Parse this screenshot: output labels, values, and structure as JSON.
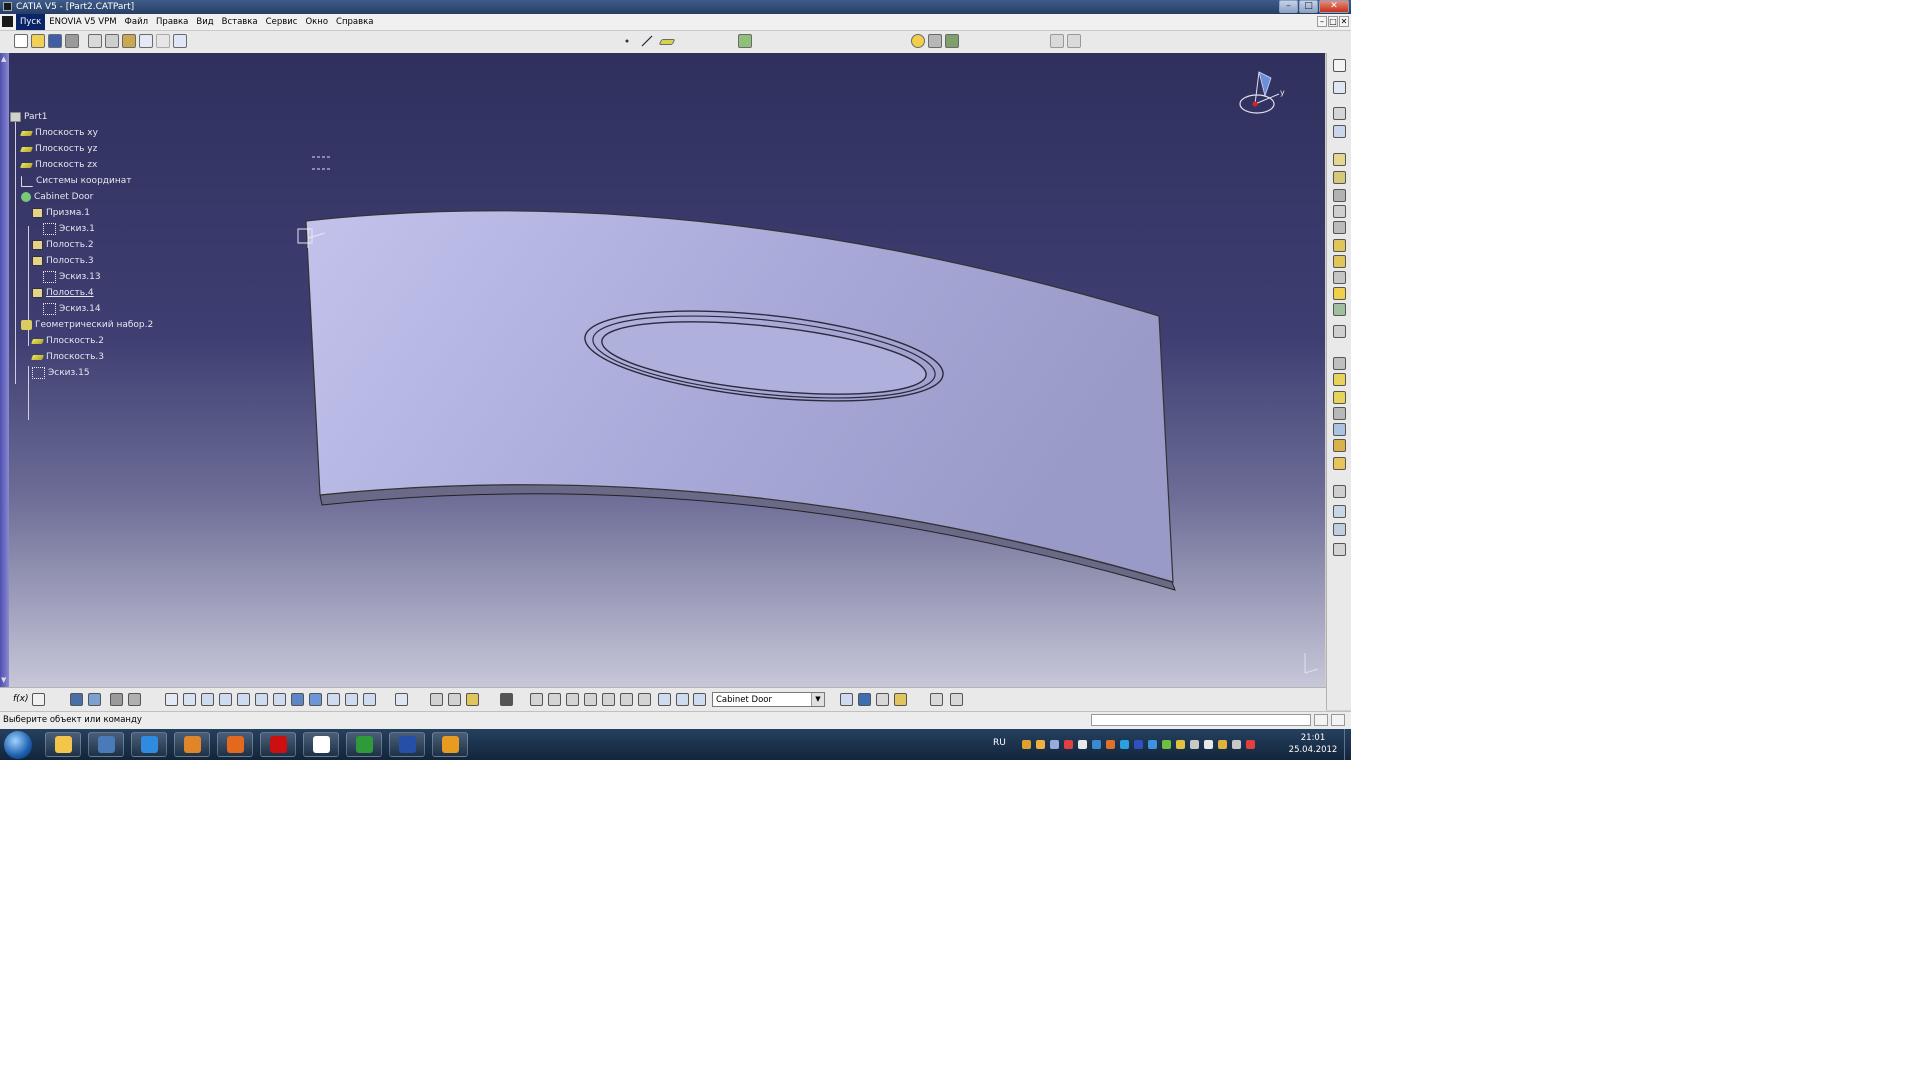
{
  "window": {
    "title": "CATIA V5 - [Part2.CATPart]",
    "controls": [
      "–",
      "□",
      "✕"
    ]
  },
  "menu": {
    "items": [
      "Пуск",
      "ENOVIA V5 VPM",
      "Файл",
      "Правка",
      "Вид",
      "Вставка",
      "Сервис",
      "Окно",
      "Справка"
    ],
    "active_index": 0,
    "doc_controls": [
      "–",
      "□",
      "✕"
    ]
  },
  "tree": {
    "nodes": [
      {
        "label": "Part1",
        "icon": "part-icon",
        "level": 0
      },
      {
        "label": "Плоскость xy",
        "icon": "plane-icon",
        "level": 1
      },
      {
        "label": "Плоскость yz",
        "icon": "plane-icon",
        "level": 1
      },
      {
        "label": "Плоскость zx",
        "icon": "plane-icon",
        "level": 1
      },
      {
        "label": "Системы координат",
        "icon": "axis-system-icon",
        "level": 1
      },
      {
        "label": "Cabinet Door",
        "icon": "part-body-icon",
        "level": 1
      },
      {
        "label": "Призма.1",
        "icon": "pad-icon",
        "level": 2
      },
      {
        "label": "Эскиз.1",
        "icon": "sketch-icon",
        "level": 3
      },
      {
        "label": "Полость.2",
        "icon": "pocket-icon",
        "level": 2
      },
      {
        "label": "Полость.3",
        "icon": "pocket-icon",
        "level": 2
      },
      {
        "label": "Эскиз.13",
        "icon": "sketch-icon",
        "level": 3
      },
      {
        "label": "Полость.4",
        "icon": "pocket-icon",
        "level": 2
      },
      {
        "label": "Эскиз.14",
        "icon": "sketch-icon",
        "level": 3
      },
      {
        "label": "Геометрический набор.2",
        "icon": "geometrical-set-icon",
        "level": 1
      },
      {
        "label": "Плоскость.2",
        "icon": "plane-icon",
        "level": 2
      },
      {
        "label": "Плоскость.3",
        "icon": "plane-icon",
        "level": 2
      },
      {
        "label": "Эскиз.15",
        "icon": "sketch-icon",
        "level": 2
      }
    ],
    "current_index": 11
  },
  "compass": {
    "axis_label": "y"
  },
  "bottom_toolbar": {
    "fx_label": "f(x)",
    "body_combo_value": "Cabinet Door"
  },
  "status": {
    "message": "Выберите объект или команду"
  },
  "taskbar": {
    "language": "RU",
    "time": "21:01",
    "date": "25.04.2012",
    "apps": [
      "windows-explorer-icon",
      "catia-icon",
      "internet-explorer-icon",
      "media-player-icon",
      "firefox-icon",
      "opera-icon",
      "image-viewer-icon",
      "utorrent-icon",
      "save-disk-icon",
      "archive-icon"
    ]
  },
  "colors": {
    "viewport_top": "#30305e",
    "viewport_bottom": "#c7c7d9",
    "part_face": "#b8b8e4",
    "selection": "#0a246a"
  }
}
